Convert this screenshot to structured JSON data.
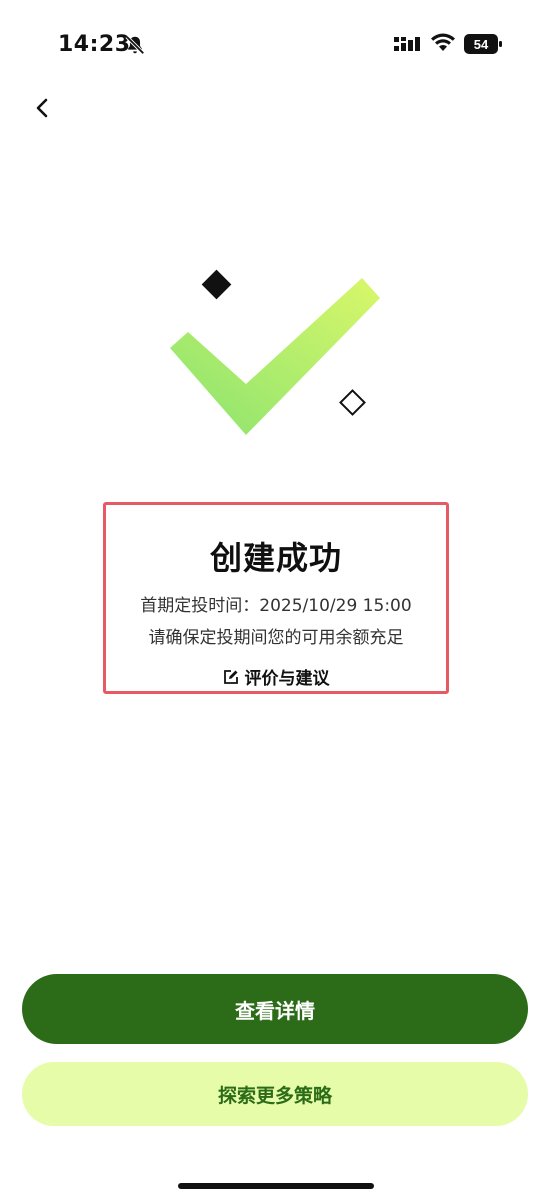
{
  "status_bar": {
    "time": "14:23",
    "battery": "54",
    "icons": [
      "bell-slash-icon",
      "signal-icon",
      "wifi-icon",
      "battery-icon"
    ]
  },
  "nav": {
    "back_icon": "chevron-left-icon"
  },
  "result": {
    "title": "创建成功",
    "first_time": "首期定投时间：2025/10/29 15:00",
    "notice": "请确保定投期间您的可用余额充足",
    "feedback_label": "评价与建议",
    "feedback_icon": "edit-icon"
  },
  "buttons": {
    "view_details": "查看详情",
    "explore_more": "探索更多策略"
  },
  "colors": {
    "primary": "#2c6c18",
    "secondary_bg": "#e6fca9",
    "check_start": "#8ae36f",
    "check_end": "#d9f76a",
    "highlight_border": "#e65a63"
  }
}
